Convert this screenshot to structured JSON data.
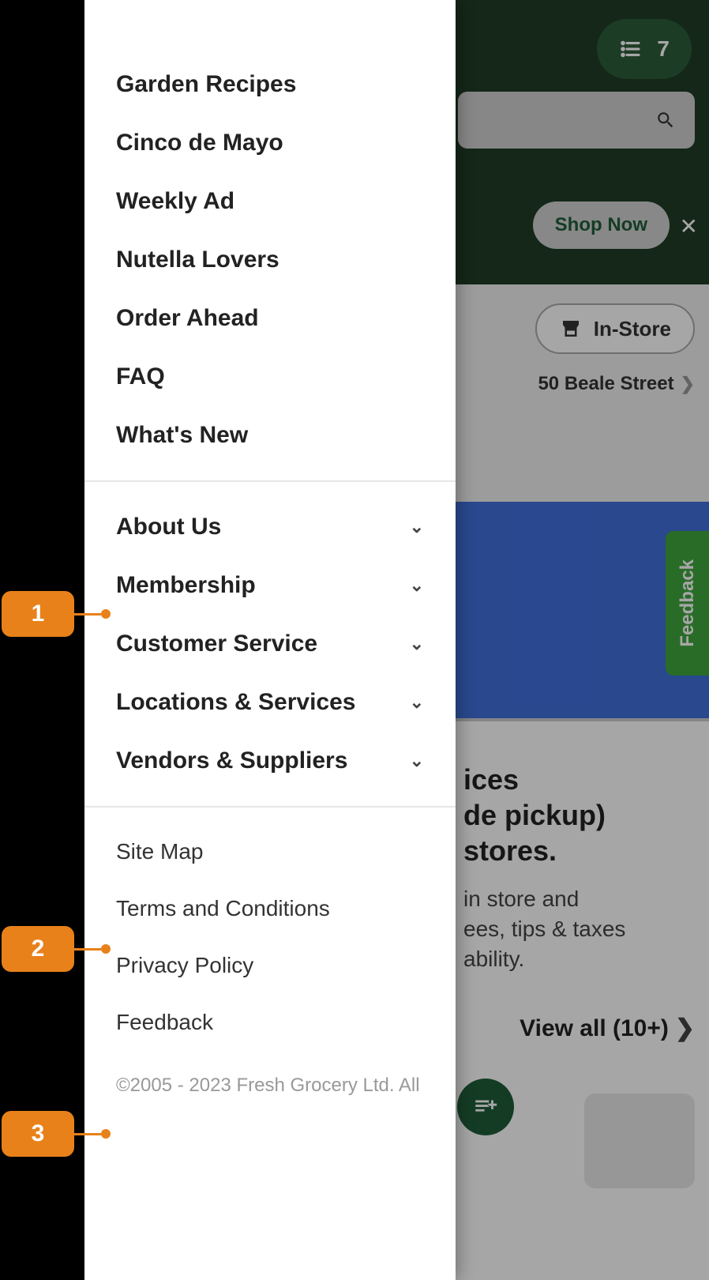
{
  "header": {
    "cart_count": "7",
    "shop_now_label": "Shop Now"
  },
  "location": {
    "instore_label": "In-Store",
    "address": "50 Beale Street"
  },
  "content": {
    "heading_line1": "ices",
    "heading_line2": "de pickup)",
    "heading_line3": "stores.",
    "body_line1": "in store and",
    "body_line2": "ees, tips & taxes",
    "body_line3": "ability.",
    "view_all_label": "View all (10+)"
  },
  "feedback_label": "Feedback",
  "drawer": {
    "section1": [
      "Garden Recipes",
      "Cinco de Mayo",
      "Weekly Ad",
      "Nutella Lovers",
      "Order Ahead",
      "FAQ",
      "What's New"
    ],
    "section2": [
      "About Us",
      "Membership",
      "Customer Service",
      "Locations & Services",
      "Vendors & Suppliers"
    ],
    "section3": [
      "Site Map",
      "Terms and Conditions",
      "Privacy Policy",
      "Feedback"
    ],
    "copyright": "©2005 - 2023 Fresh Grocery Ltd. All"
  },
  "markers": [
    "1",
    "2",
    "3"
  ]
}
